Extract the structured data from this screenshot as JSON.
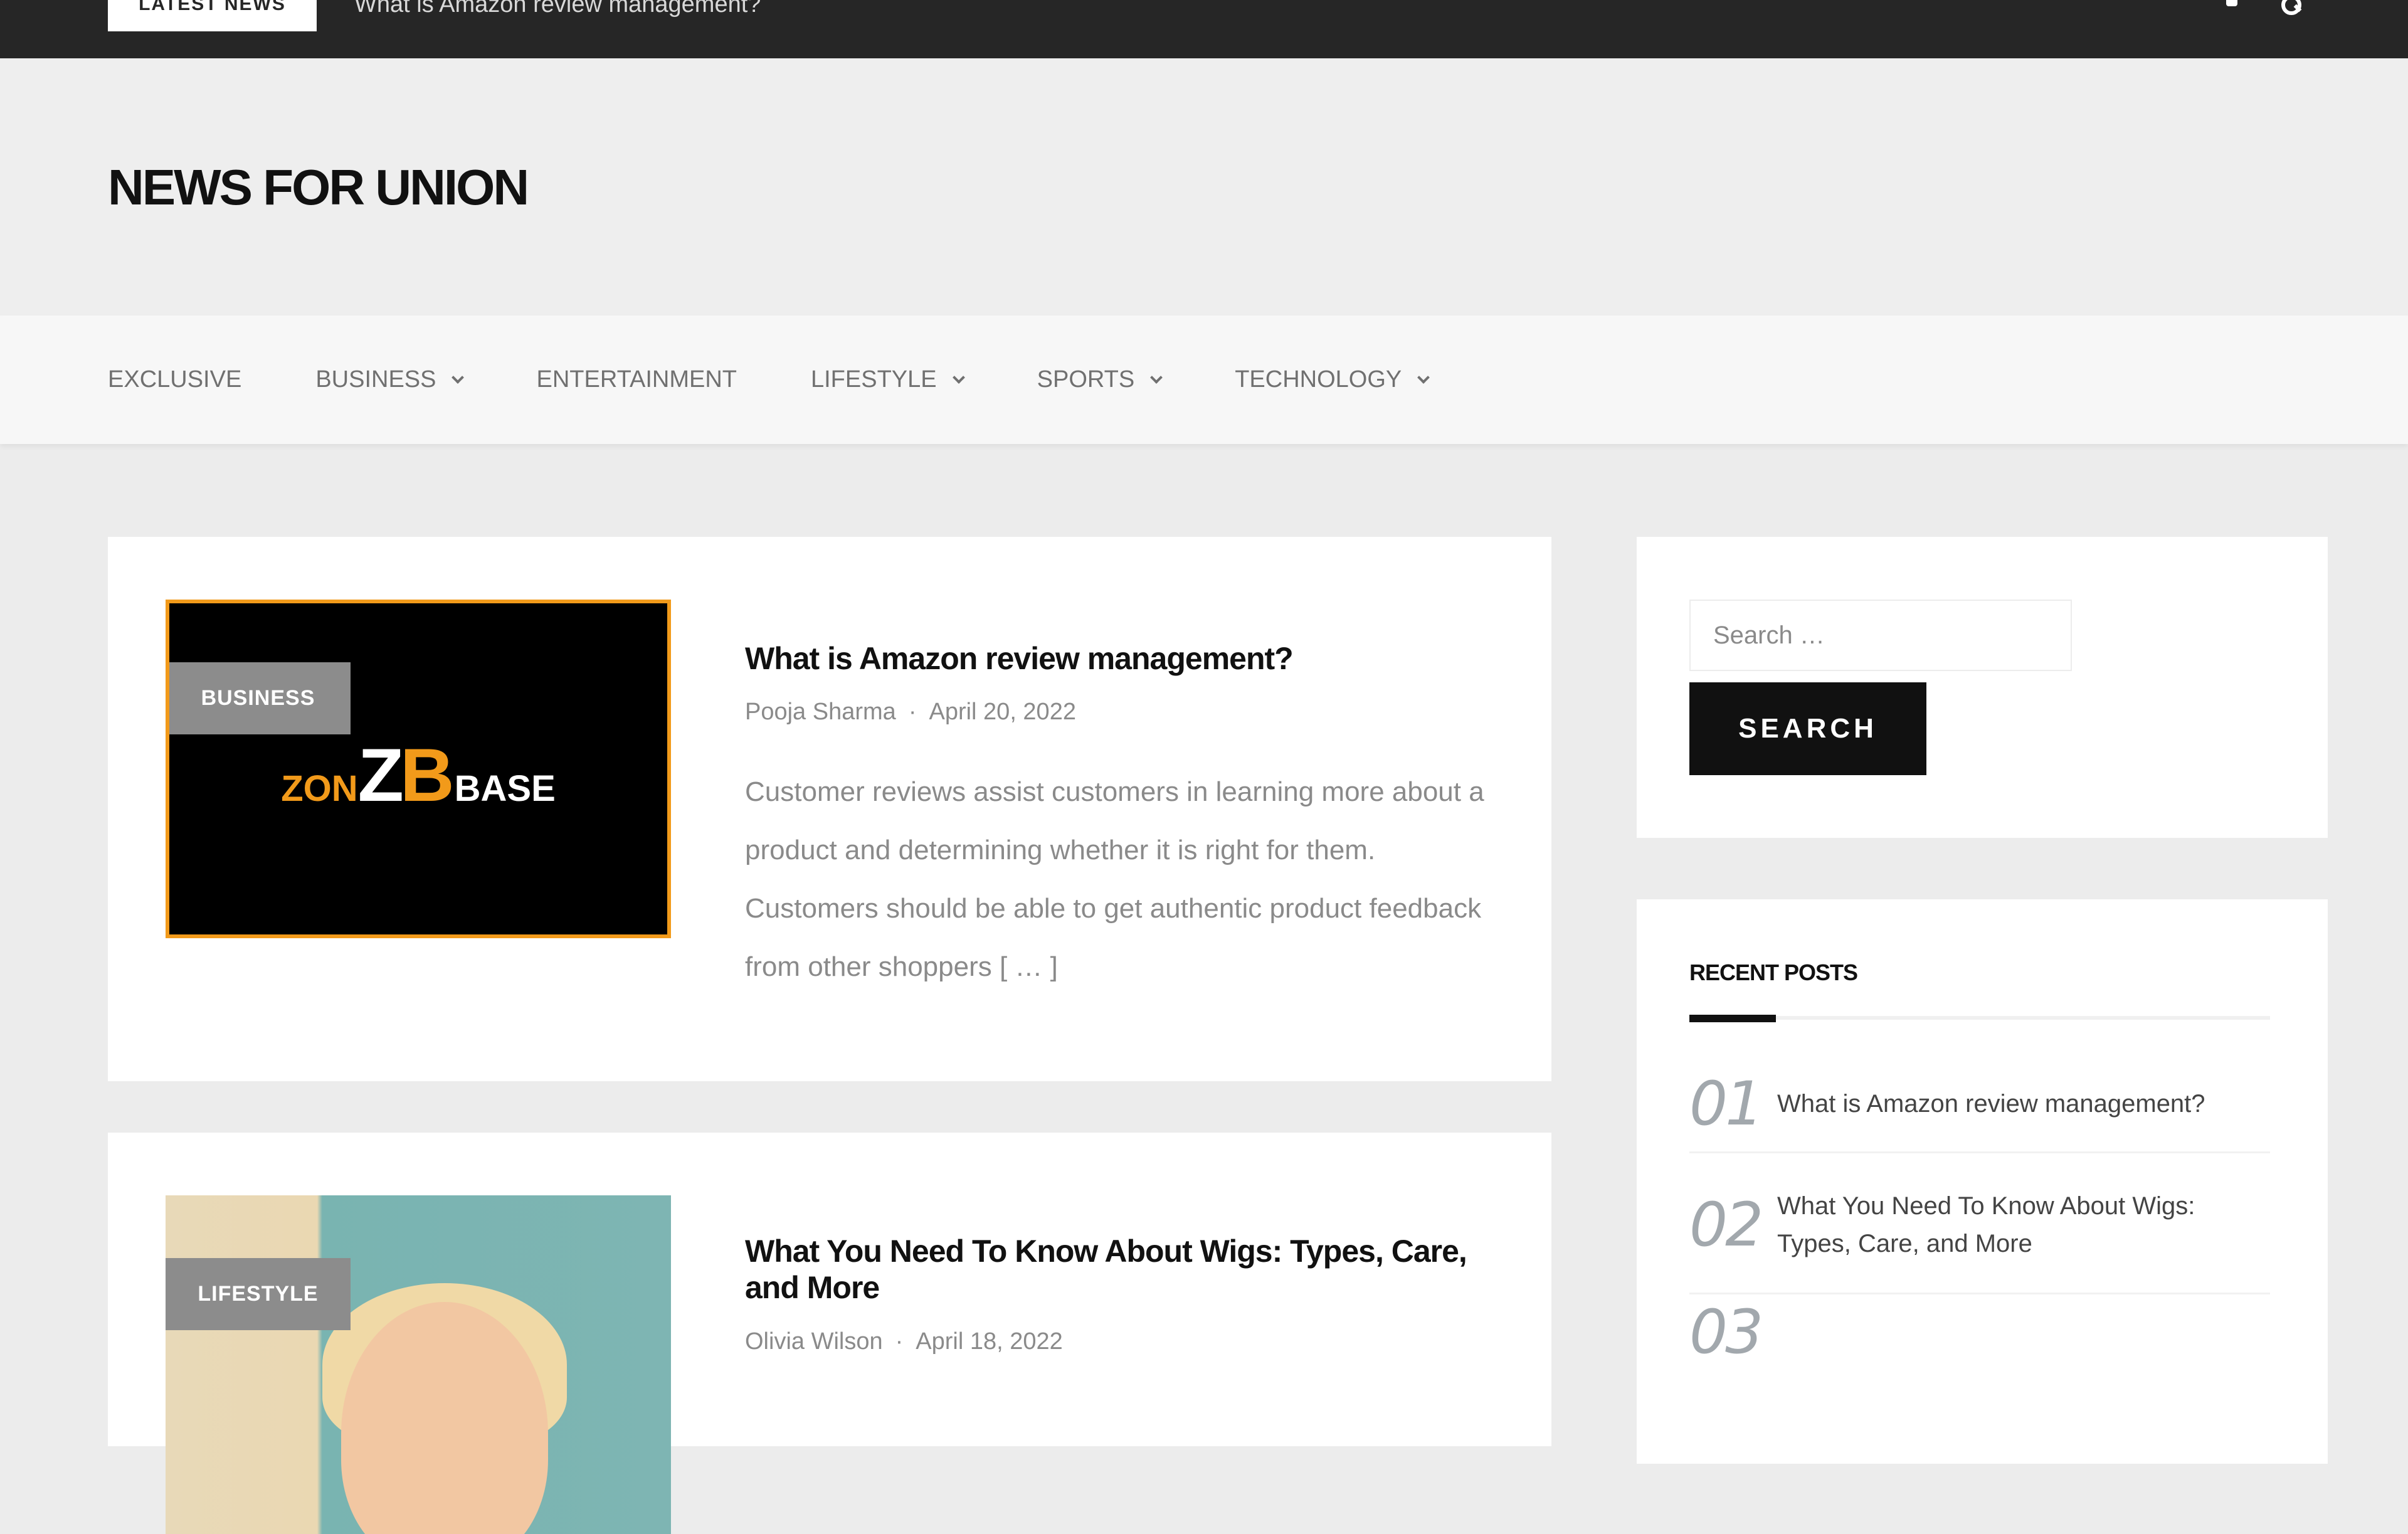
{
  "topbar": {
    "latest_label": "Latest News",
    "ticker": "What is Amazon review management?",
    "icons": [
      "user-icon",
      "search-icon"
    ]
  },
  "header": {
    "site_title": "NEWS FOR UNION"
  },
  "nav": {
    "items": [
      {
        "label": "Exclusive",
        "has_dropdown": false
      },
      {
        "label": "Business",
        "has_dropdown": true
      },
      {
        "label": "Entertainment",
        "has_dropdown": false
      },
      {
        "label": "Lifestyle",
        "has_dropdown": true
      },
      {
        "label": "Sports",
        "has_dropdown": true
      },
      {
        "label": "Technology",
        "has_dropdown": true
      }
    ]
  },
  "posts": [
    {
      "category": "Business",
      "thumb_logo": {
        "zon": "ZON",
        "z": "Z",
        "b": "B",
        "base": "BASE"
      },
      "title": "What is Amazon review management?",
      "author": "Pooja Sharma",
      "date": "April 20, 2022",
      "excerpt": "Customer reviews assist customers in learning more about a product and determining whether it is right for them. Customers should be able to get authentic product feedback from other shoppers [ … ]"
    },
    {
      "category": "Lifestyle",
      "title": "What You Need To Know About Wigs: Types, Care, and More",
      "author": "Olivia Wilson",
      "date": "April 18, 2022"
    }
  ],
  "sidebar": {
    "search": {
      "placeholder": "Search …",
      "button_label": "Search"
    },
    "recent": {
      "title": "Recent Posts",
      "items": [
        {
          "num": "01",
          "title": "What is Amazon review management?"
        },
        {
          "num": "02",
          "title": "What You Need To Know About Wigs: Types, Care, and More"
        },
        {
          "num": "03",
          "title": ""
        }
      ]
    }
  },
  "colors": {
    "topbar": "#262626",
    "accent_orange": "#f29a1a",
    "badge_gray": "#8c8c8c",
    "button_black": "#111111"
  }
}
